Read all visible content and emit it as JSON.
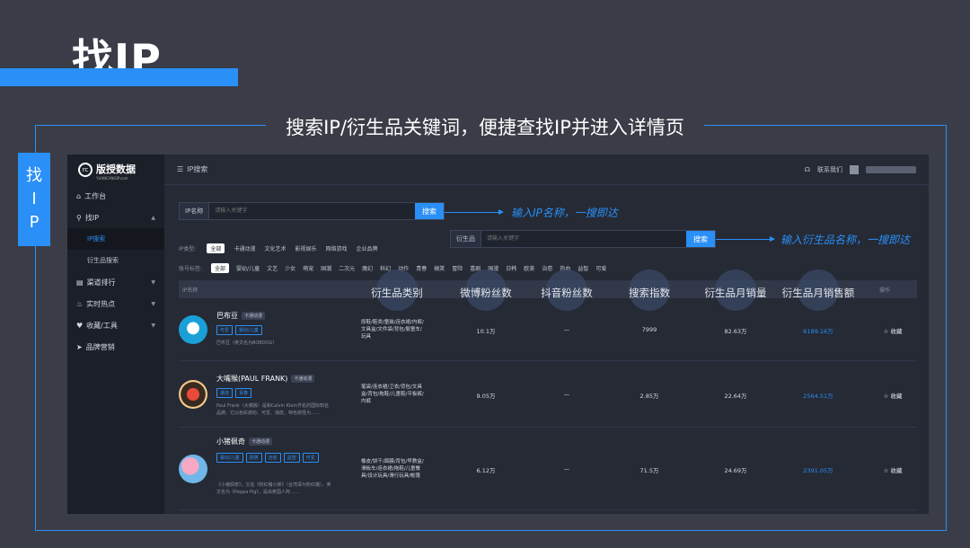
{
  "slide": {
    "title": "找IP",
    "subtitle": "搜索IP/衍生品关键词，便捷查找IP并进入详情页",
    "side_tab": [
      "找",
      "I",
      "P"
    ]
  },
  "colors": {
    "accent": "#2a8ff7",
    "bg": "#3a3d47",
    "app_bg": "#252a35",
    "sidebar_bg": "#1b1f28"
  },
  "app": {
    "logo_text": "版授数据",
    "logo_sub": "YUANCANGIP.com",
    "logo_mark": "rc",
    "menu": [
      {
        "label": "工作台",
        "icon": "home-icon"
      },
      {
        "label": "找IP",
        "icon": "search-icon",
        "expanded": true
      },
      {
        "label": "IP搜索",
        "sub": true,
        "active": true
      },
      {
        "label": "衍生品搜索",
        "sub": true
      },
      {
        "label": "渠道排行",
        "icon": "chart-icon"
      },
      {
        "label": "实时热点",
        "icon": "flame-icon"
      },
      {
        "label": "收藏/工具",
        "icon": "heart-icon"
      },
      {
        "label": "品牌营销",
        "icon": "send-icon"
      }
    ],
    "topbar": {
      "crumb": "IP搜索",
      "contact": "联系我们"
    },
    "search_ip": {
      "label": "IP名称",
      "placeholder": "请输入关键字",
      "button": "搜索"
    },
    "search_product": {
      "label": "衍生品",
      "placeholder": "请输入关键字",
      "button": "搜索"
    },
    "anno_ip": "输入IP名称，一搜即达",
    "anno_product": "输入衍生品名称，一搜即达",
    "filter_type": {
      "label": "IP类型:",
      "chips": [
        "全部",
        "卡通动漫",
        "文化艺术",
        "影视娱乐",
        "网络游戏",
        "企业品牌"
      ]
    },
    "filter_tag": {
      "label": "账号标签:",
      "chips": [
        "全部",
        "婴幼/儿童",
        "文艺",
        "少女",
        "萌宠",
        "国潮",
        "二次元",
        "魔幻",
        "科幻",
        "动作",
        "青春",
        "搞笑",
        "冒险",
        "喜剧",
        "国漫",
        "日韩",
        "欧美",
        "治愈",
        "热血",
        "益智",
        "可爱"
      ]
    },
    "table": {
      "header_ip": "IP名称",
      "header_action": "操作",
      "columns": [
        "衍生品类别",
        "微博粉丝数",
        "抖音粉丝数",
        "搜索指数",
        "衍生品月销量",
        "衍生品月销售额"
      ],
      "rows": [
        {
          "name": "巴布豆",
          "badge": "卡通动漫",
          "tags": [
            "可爱",
            "婴幼/儿童"
          ],
          "desc": "巴布豆（英文名为BOBDOG）",
          "category": "原鞋/鞋类/童装/连衣裙/内裤/文具盒/文件袋/背包/婴童车/玩具",
          "weibo": "10.1万",
          "douyin": "—",
          "search": "7999",
          "monthly_sales": "82.63万",
          "monthly_revenue": "6189.16万",
          "action": "☆ 收藏"
        },
        {
          "name": "大嘴猴(PAUL FRANK)",
          "badge": "卡通动漫",
          "tags": [
            "潮流",
            "青春"
          ],
          "desc": "Paul Frank（大嘴猴）是和Calvin Klein齐名的国际知名品牌。它以色彩缤纷、可爱、俏皮、特色搞怪为……",
          "category": "笔袋/连衣裙/卫衣/背包/文具盒/背包/拖鞋/儿童鞋/平板裤/内裤",
          "weibo": "9.05万",
          "douyin": "—",
          "search": "2.85万",
          "monthly_sales": "22.64万",
          "monthly_revenue": "2564.51万",
          "action": "☆ 收藏"
        },
        {
          "name": "小猪佩奇",
          "badge": "卡通动漫",
          "tags": [
            "婴幼/儿童",
            "搞笑",
            "治愈",
            "益智",
            "可爱"
          ],
          "desc": "《小猪佩奇》，又名《粉红猪小妹》（台湾译为粉红猪），英文名为《Peppa Pig》，是由英国人阿……",
          "category": "橡皮/饼干/面膜/背包/早教盒/滑板车/连衣裙/拖鞋/儿童餐具/设计玩具/滑行玩具/帐篷",
          "weibo": "6.12万",
          "douyin": "—",
          "search": "71.5万",
          "monthly_sales": "24.69万",
          "monthly_revenue": "2391.05万",
          "action": "☆ 收藏"
        }
      ]
    }
  }
}
